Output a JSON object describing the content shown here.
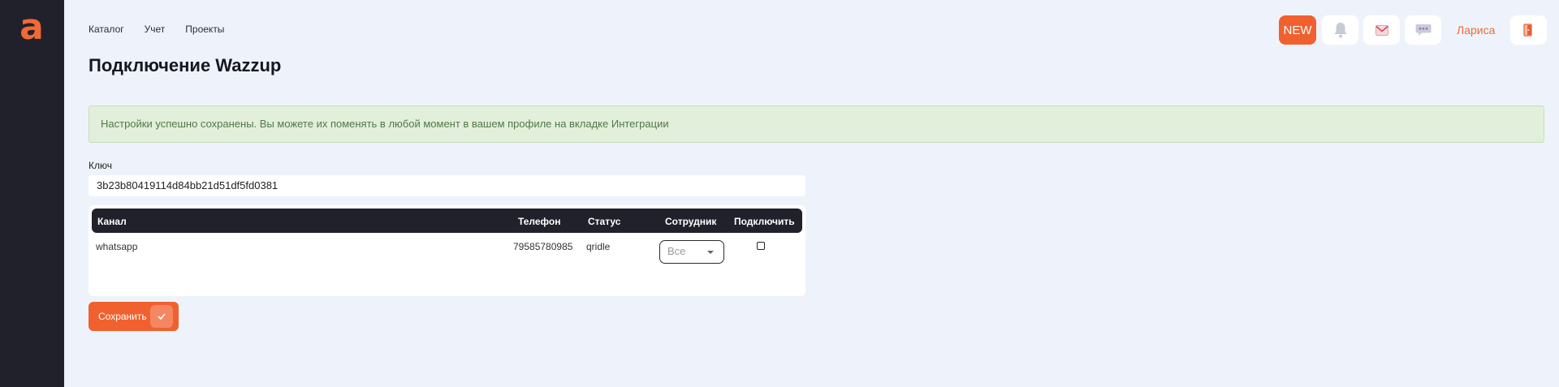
{
  "brand": {
    "logo_letter": "a",
    "accent": "#f06a36"
  },
  "nav": {
    "items": [
      {
        "label": "Каталог"
      },
      {
        "label": "Учет"
      },
      {
        "label": "Проекты"
      }
    ]
  },
  "header": {
    "new_label": "NEW",
    "user_name": "Лариса",
    "icons": [
      "bell-icon",
      "mail-icon",
      "chat-icon",
      "logout-icon"
    ]
  },
  "page": {
    "title": "Подключение Wazzup"
  },
  "alert": {
    "text": "Настройки успешно сохранены. Вы можете их поменять в любой момент в вашем профиле на вкладке Интеграции"
  },
  "form": {
    "key_label": "Ключ",
    "key_value": "3b23b80419114d84bb21d51df5fd0381"
  },
  "table": {
    "columns": [
      "Канал",
      "Телефон",
      "Статус",
      "Сотрудник",
      "Подключить"
    ],
    "rows": [
      {
        "channel": "whatsapp",
        "phone": "79585780985",
        "status": "qridle",
        "employee": "Все",
        "connected": false
      }
    ]
  },
  "actions": {
    "save_label": "Сохранить"
  }
}
